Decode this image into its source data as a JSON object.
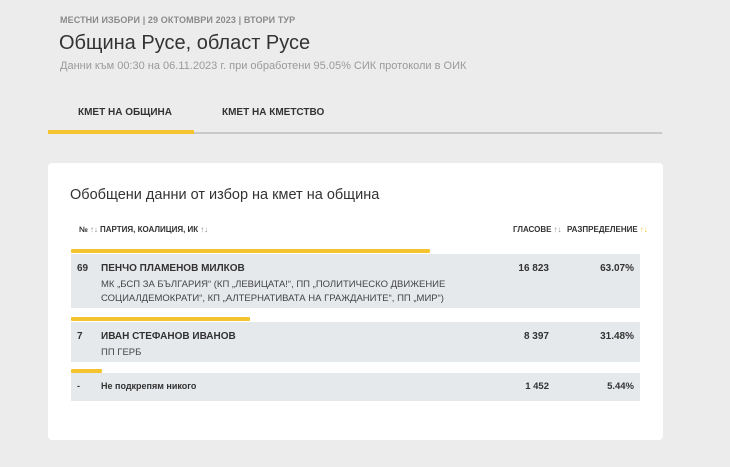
{
  "header": {
    "kicker": "МЕСТНИ ИЗБОРИ | 29 ОКТОМВРИ 2023 | ВТОРИ ТУР",
    "title": "Община Русе, област Русе",
    "subtitle": "Данни към 00:30 на 06.11.2023 г. при обработени 95.05% СИК протоколи в ОИК"
  },
  "tabs": [
    {
      "label": "КМЕТ НА ОБЩИНА",
      "active": true
    },
    {
      "label": "КМЕТ НА КМЕТСТВО",
      "active": false
    }
  ],
  "table": {
    "title": "Обобщени данни от избор на кмет на община",
    "headers": {
      "number": "№",
      "party": "ПАРТИЯ, КОАЛИЦИЯ, ИК",
      "votes": "ГЛАСОВЕ",
      "distribution": "РАЗПРЕДЕЛЕНИЕ"
    },
    "sort_icon": "↑↓",
    "sort_icon_active": "↑↓",
    "accent_color": "#f4c430",
    "rows": [
      {
        "number": "69",
        "name": "ПЕНЧО ПЛАМЕНОВ МИЛКОВ",
        "party": "МК „БСП ЗА БЪЛГАРИЯ“ (КП „ЛЕВИЦАТА!“, ПП „ПОЛИТИЧЕСКО ДВИЖЕНИЕ СОЦИАЛДЕМОКРАТИ“, КП „АЛТЕРНАТИВАТА НА ГРАЖДАНИТЕ“, ПП „МИР“)",
        "votes": "16 823",
        "percent": "63.07%",
        "share": 0.6307
      },
      {
        "number": "7",
        "name": "ИВАН СТЕФАНОВ ИВАНОВ",
        "party": "ПП ГЕРБ",
        "votes": "8 397",
        "percent": "31.48%",
        "share": 0.3148
      },
      {
        "number": "-",
        "name": "Не подкрепям никого",
        "party": "",
        "votes": "1 452",
        "percent": "5.44%",
        "share": 0.0544
      }
    ]
  }
}
